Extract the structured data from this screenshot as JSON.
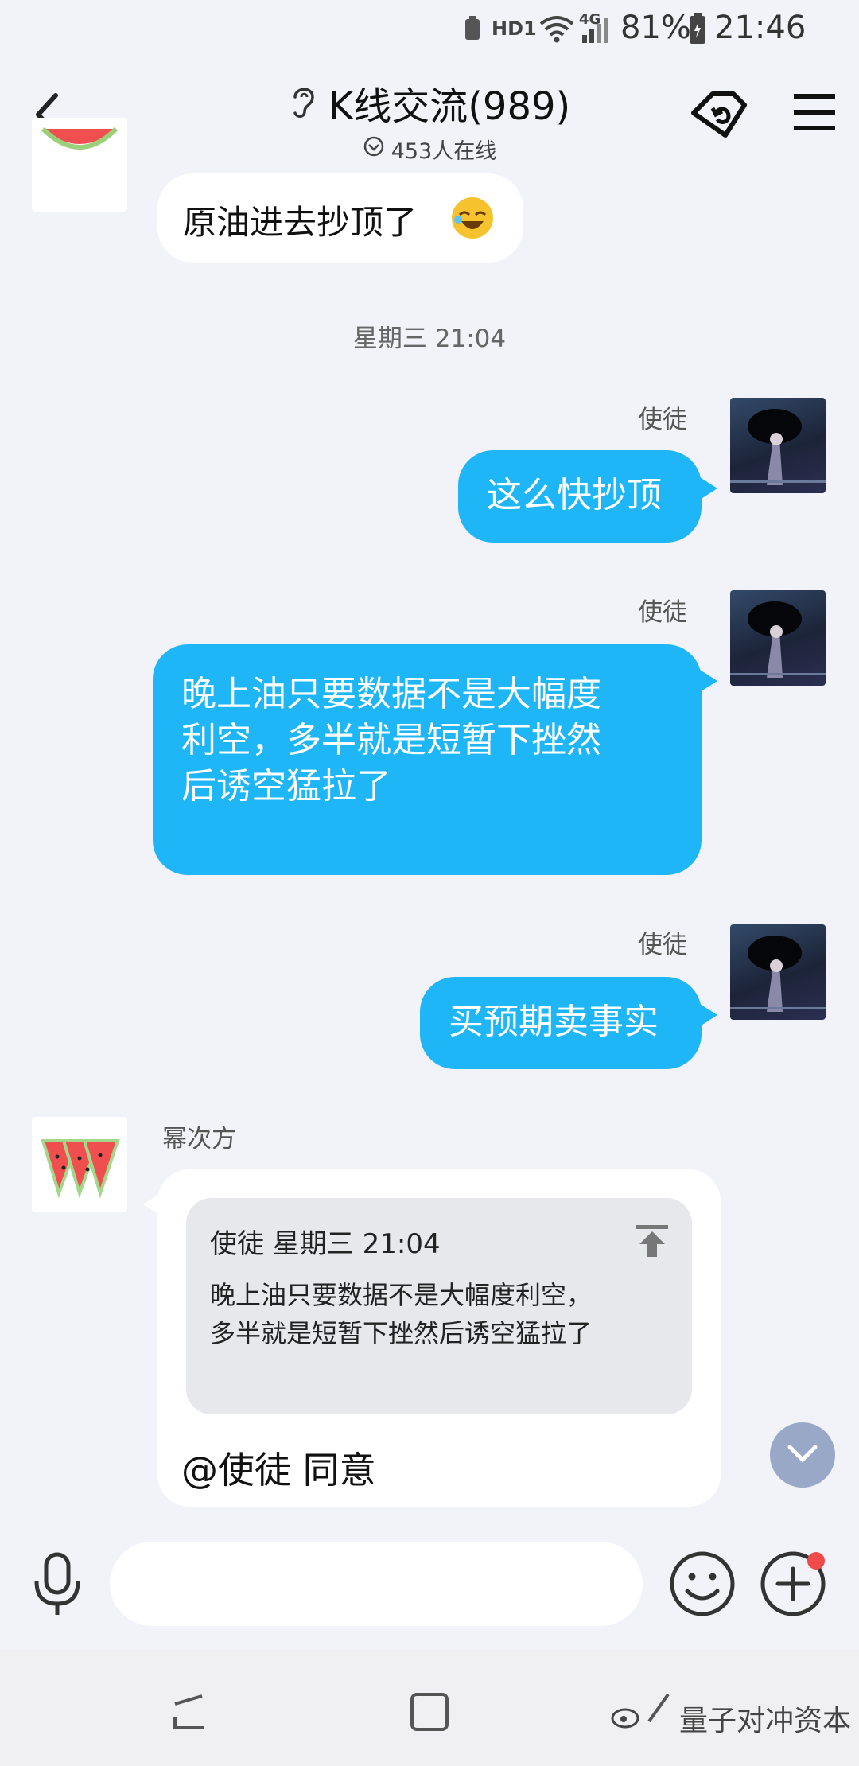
{
  "status_bar": {
    "network": "HD1",
    "signal_type": "4G",
    "battery": "81%",
    "time": "21:46"
  },
  "header": {
    "title": "K线交流(989)",
    "online": "453人在线"
  },
  "messages": {
    "first": {
      "text": "原油进去抄顶了"
    },
    "timestamp": "星期三 21:04",
    "m1": {
      "sender": "使徒",
      "text": "这么快抄顶"
    },
    "m2": {
      "sender": "使徒",
      "line1": "晚上油只要数据不是大幅度",
      "line2": "利空，多半就是短暂下挫然",
      "line3": "后诱空猛拉了"
    },
    "m3": {
      "sender": "使徒",
      "text": "买预期卖事实"
    },
    "m4": {
      "sender": "幂次方",
      "quote_head": "使徒 星期三 21:04",
      "quote_line1": "晚上油只要数据不是大幅度利空，",
      "quote_line2": "多半就是短暂下挫然后诱空猛拉了",
      "reply": "@使徒 同意"
    }
  },
  "input": {
    "placeholder": ""
  },
  "watermark": "量子对冲资本",
  "icons": {
    "back": "back-arrow-icon",
    "ear": "ear-icon",
    "loop": "loop-tag-icon",
    "menu": "menu-icon",
    "mic": "microphone-icon",
    "emoji": "emoji-icon",
    "plus": "plus-icon"
  },
  "colors": {
    "accent": "#1fb6f7",
    "background": "#f1f3f8",
    "notification_dot": "#f04a4a"
  }
}
